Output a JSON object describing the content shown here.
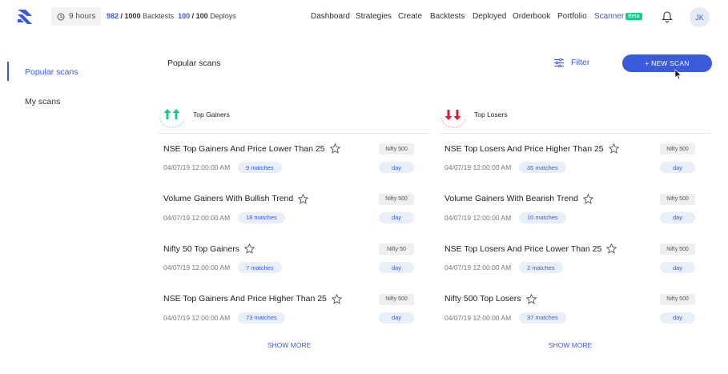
{
  "header": {
    "hours_label": "9 hours",
    "backtests_used": "982",
    "backtests_total": "/ 1000",
    "backtests_label": "Backtests",
    "deploys_used": "100",
    "deploys_total": "/ 100",
    "deploys_label": "Deploys",
    "nav": [
      "Dashboard",
      "Strategies",
      "Create",
      "Backtests",
      "Deployed",
      "Orderbook",
      "Portfolio",
      "Scanner"
    ],
    "beta_badge": "Beta",
    "avatar_initials": "JK"
  },
  "sidebar": {
    "items": [
      "Popular scans",
      "My scans"
    ]
  },
  "main": {
    "title": "Popular scans",
    "filter_label": "Filter",
    "new_scan_label": "+ NEW SCAN"
  },
  "columns": [
    {
      "title": "Top Gainers",
      "show_more": "SHOW MORE",
      "rows": [
        {
          "name": "NSE Top Gainers And Price Lower Than 25",
          "date": "04/07/19 12:00:00 AM",
          "matches": "9 matches",
          "index": "Nifty 500",
          "freq": "day"
        },
        {
          "name": "Volume Gainers With Bullish Trend",
          "date": "04/07/19 12:00:00 AM",
          "matches": "18 matches",
          "index": "Nifty 500",
          "freq": "day"
        },
        {
          "name": "Nifty 50 Top Gainers",
          "date": "04/07/19 12:00:00 AM",
          "matches": "7 matches",
          "index": "Nifty 50",
          "freq": "day"
        },
        {
          "name": "NSE Top Gainers And Price Higher Than 25",
          "date": "04/07/19 12:00:00 AM",
          "matches": "73 matches",
          "index": "Nifty 500",
          "freq": "day"
        }
      ]
    },
    {
      "title": "Top Losers",
      "show_more": "SHOW MORE",
      "rows": [
        {
          "name": "NSE Top Losers And Price Higher Than 25",
          "date": "04/07/19 12:00:00 AM",
          "matches": "35 matches",
          "index": "Nifty 500",
          "freq": "day"
        },
        {
          "name": "Volume Gainers With Bearish Trend",
          "date": "04/07/19 12:00:00 AM",
          "matches": "10 matches",
          "index": "Nifty 500",
          "freq": "day"
        },
        {
          "name": "NSE Top Losers And Price Lower Than 25",
          "date": "04/07/19 12:00:00 AM",
          "matches": "2 matches",
          "index": "Nifty 500",
          "freq": "day"
        },
        {
          "name": "Nifty 500 Top Losers",
          "date": "04/07/19 12:00:00 AM",
          "matches": "37 matches",
          "index": "Nifty 500",
          "freq": "day"
        }
      ]
    }
  ],
  "colors": {
    "accent": "#3b5bdb",
    "gain": "#1bc98e",
    "loss": "#e0193c"
  }
}
